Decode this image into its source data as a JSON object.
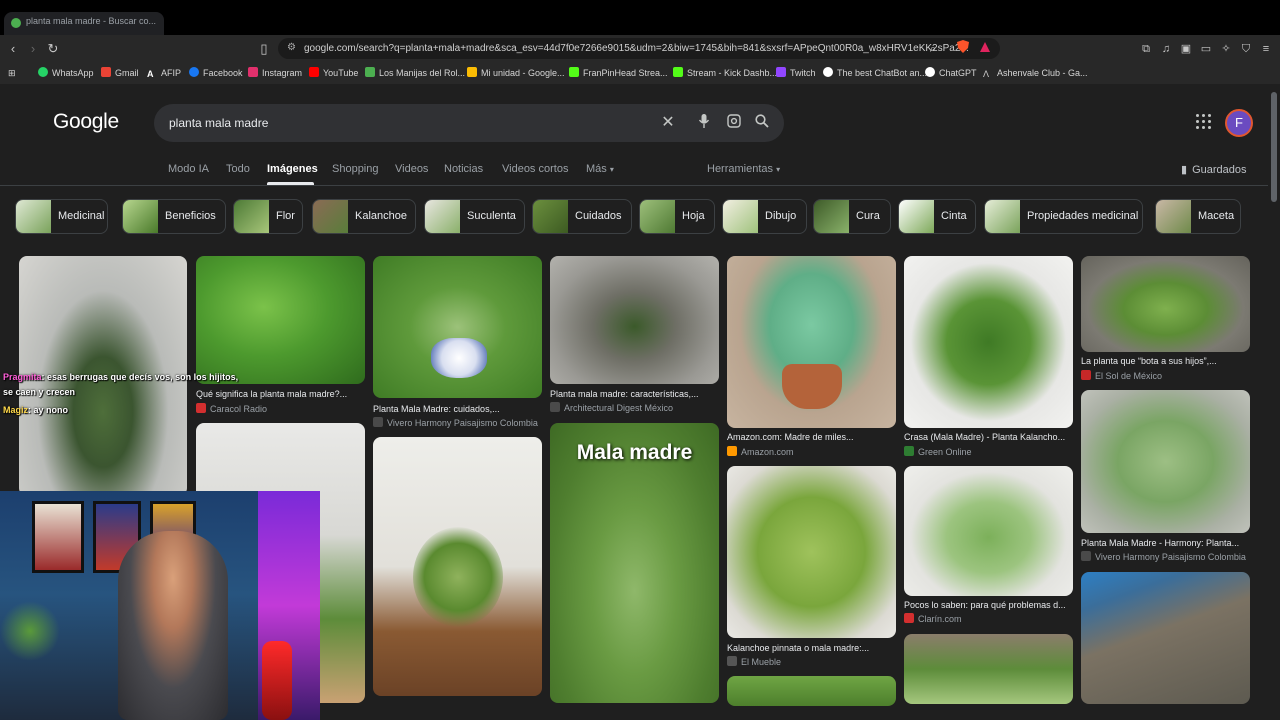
{
  "browser": {
    "tab_title": "planta mala madre - Buscar co...",
    "url": "google.com/search?q=planta+mala+madre&sca_esv=44d7f0e7266e9015&udm=2&biw=1745&bih=841&sxsrf=APpeQnt00R0a_w8xHRV1eKK2sPa2...",
    "bookmarks": [
      {
        "label": "WhatsApp",
        "color": "#25d366"
      },
      {
        "label": "Gmail",
        "color": "#ea4335"
      },
      {
        "label": "AFIP",
        "color": "#ffffff"
      },
      {
        "label": "Facebook",
        "color": "#1877f2"
      },
      {
        "label": "Instagram",
        "color": "#e1306c"
      },
      {
        "label": "YouTube",
        "color": "#ff0000"
      },
      {
        "label": "Los Manijas del Rol...",
        "color": "#4caf50"
      },
      {
        "label": "Mi unidad - Google...",
        "color": "#fbbc04"
      },
      {
        "label": "FranPinHead Strea...",
        "color": "#53fc18"
      },
      {
        "label": "Stream - Kick Dashb...",
        "color": "#53fc18"
      },
      {
        "label": "Twitch",
        "color": "#9146ff"
      },
      {
        "label": "The best ChatBot an...",
        "color": "#ffffff"
      },
      {
        "label": "ChatGPT",
        "color": "#ffffff"
      },
      {
        "label": "Ashenvale Club - Ga...",
        "color": "#cccccc"
      }
    ]
  },
  "google": {
    "logo": "Google",
    "query": "planta mala madre",
    "tabs": [
      "Modo IA",
      "Todo",
      "Imágenes",
      "Shopping",
      "Videos",
      "Noticias",
      "Videos cortos",
      "Más"
    ],
    "active_tab": "Imágenes",
    "tools": "Herramientas",
    "saved": "Guardados",
    "avatar_letter": "F",
    "chips": [
      "Medicinal",
      "Beneficios",
      "Flor",
      "Kalanchoe",
      "Suculenta",
      "Cuidados",
      "Hoja",
      "Dibujo",
      "Cura",
      "Cinta",
      "Propiedades medicinal",
      "Maceta"
    ]
  },
  "results": [
    {
      "caption": "Qué significa la planta mala madre?...",
      "source": "Caracol Radio",
      "src_color": "#d32f2f"
    },
    {
      "caption": "Planta Mala Madre: cuidados,...",
      "source": "Vivero Harmony Paisajismo Colombia",
      "src_color": "#4a4a4a"
    },
    {
      "caption": "Planta mala madre: características,...",
      "source": "Architectural Digest México",
      "src_color": "#4a4a4a"
    },
    {
      "caption": "Amazon.com: Madre de miles...",
      "source": "Amazon.com",
      "src_color": "#ff9900"
    },
    {
      "caption": "Crasa (Mala Madre) - Planta Kalancho...",
      "source": "Green Online",
      "src_color": "#2e7d32"
    },
    {
      "caption": "La planta que “bota a sus hijos”,...",
      "source": "El Sol de México",
      "src_color": "#c62828"
    },
    {
      "caption": "Kalanchoe pinnata o mala madre:...",
      "source": "El Mueble",
      "src_color": "#555555"
    },
    {
      "caption": "Pocos lo saben: para qué problemas d...",
      "source": "Clarín.com",
      "src_color": "#d32f2f"
    },
    {
      "caption": "Planta Mala Madre - Harmony: Planta...",
      "source": "Vivero Harmony Paisajismo Colombia",
      "src_color": "#4a4a4a"
    }
  ],
  "image_overlay_text": "Mala madre",
  "stream_chat": [
    {
      "user": "Pragmita",
      "message": ": esas berrugas que decís vos, son los hijitos,"
    },
    {
      "user": "",
      "message": "se caen y crecen"
    },
    {
      "user": "Magiz",
      "message": ": ay nono"
    }
  ]
}
